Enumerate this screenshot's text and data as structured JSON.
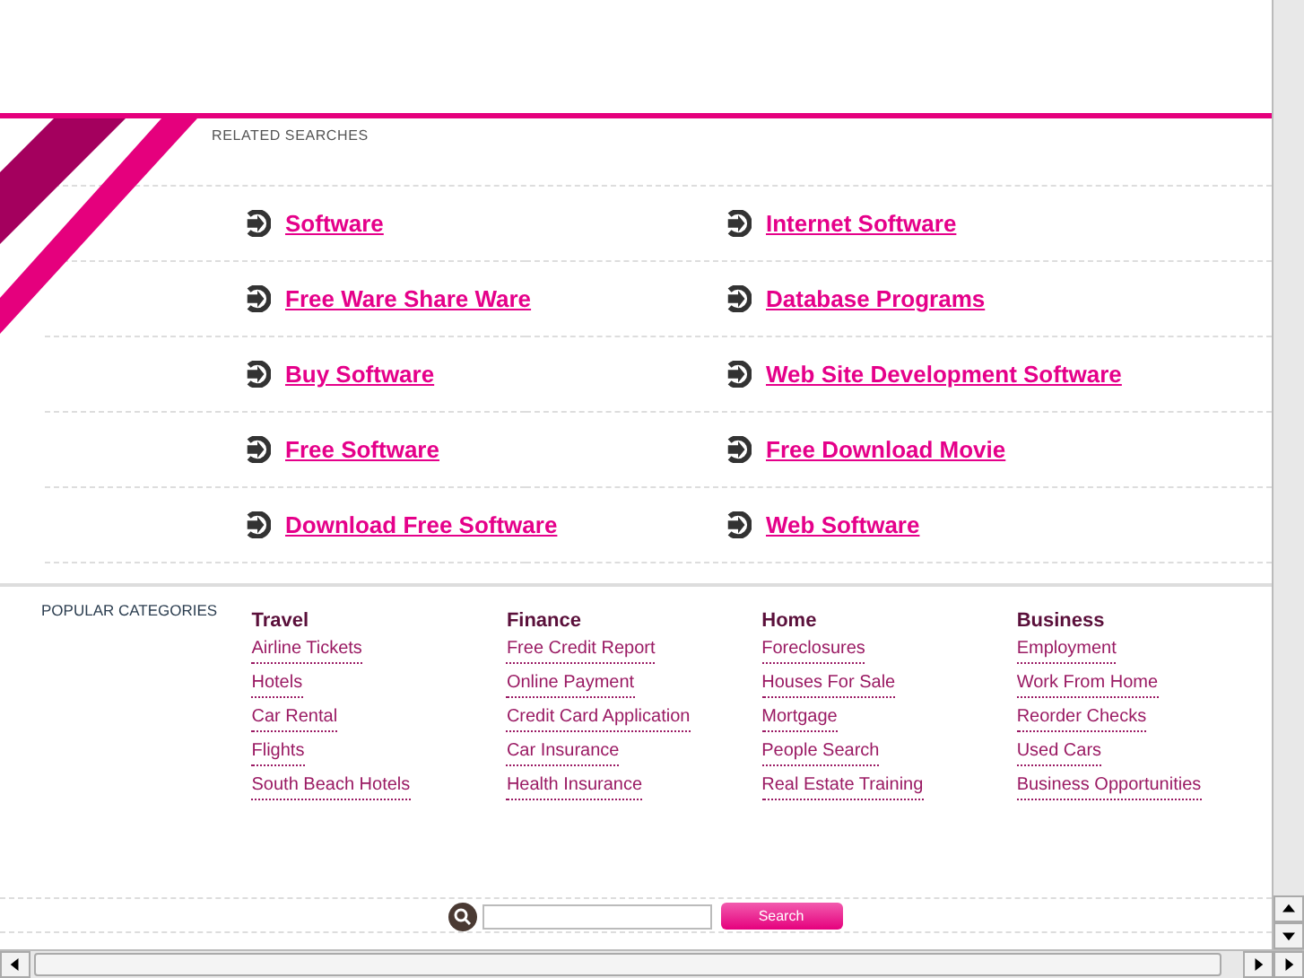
{
  "related_searches": {
    "label": "RELATED SEARCHES",
    "links": [
      {
        "text": "Software"
      },
      {
        "text": "Internet Software"
      },
      {
        "text": "Free Ware Share Ware"
      },
      {
        "text": "Database Programs"
      },
      {
        "text": "Buy Software"
      },
      {
        "text": "Web Site Development Software"
      },
      {
        "text": "Free Software"
      },
      {
        "text": "Free Download Movie"
      },
      {
        "text": "Download Free Software"
      },
      {
        "text": "Web Software"
      }
    ]
  },
  "popular_categories": {
    "label": "POPULAR CATEGORIES",
    "columns": [
      {
        "heading": "Travel",
        "items": [
          "Airline Tickets",
          "Hotels",
          "Car Rental",
          "Flights",
          "South Beach Hotels"
        ]
      },
      {
        "heading": "Finance",
        "items": [
          "Free Credit Report",
          "Online Payment",
          "Credit Card Application",
          "Car Insurance",
          "Health Insurance"
        ]
      },
      {
        "heading": "Home",
        "items": [
          "Foreclosures",
          "Houses For Sale",
          "Mortgage",
          "People Search",
          "Real Estate Training"
        ]
      },
      {
        "heading": "Business",
        "items": [
          "Employment",
          "Work From Home",
          "Reorder Checks",
          "Used Cars",
          "Business Opportunities"
        ]
      }
    ]
  },
  "search": {
    "button": "Search"
  }
}
